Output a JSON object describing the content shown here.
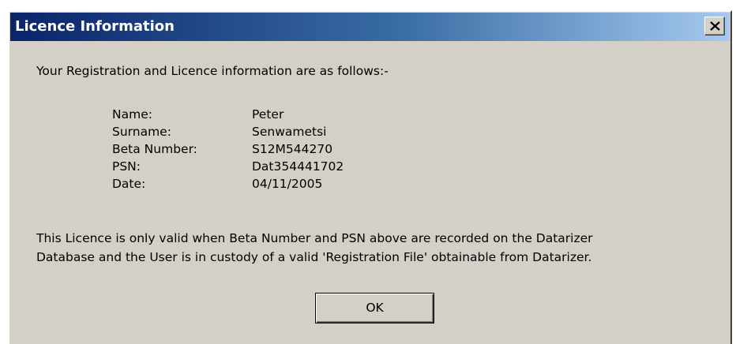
{
  "window": {
    "title": "Licence Information",
    "close_icon": "close-x-icon"
  },
  "intro_text": "Your Registration and Licence information are as follows:-",
  "licence_info": [
    {
      "label": "Name:",
      "value": "Peter"
    },
    {
      "label": "Surname:",
      "value": "Senwametsi"
    },
    {
      "label": "Beta Number:",
      "value": "S12M544270"
    },
    {
      "label": "PSN:",
      "value": "Dat354441702"
    },
    {
      "label": "Date:",
      "value": "04/11/2005"
    }
  ],
  "note_lines": [
    "This Licence is only valid when Beta Number and PSN above are recorded on the Datarizer",
    "Database and the User is in custody of a valid 'Registration File' obtainable from Datarizer."
  ],
  "buttons": {
    "ok_label": "OK"
  },
  "colors": {
    "title_gradient_start": "#0a246a",
    "title_gradient_end": "#a6caf0",
    "dialog_background": "#d4d0c8"
  }
}
